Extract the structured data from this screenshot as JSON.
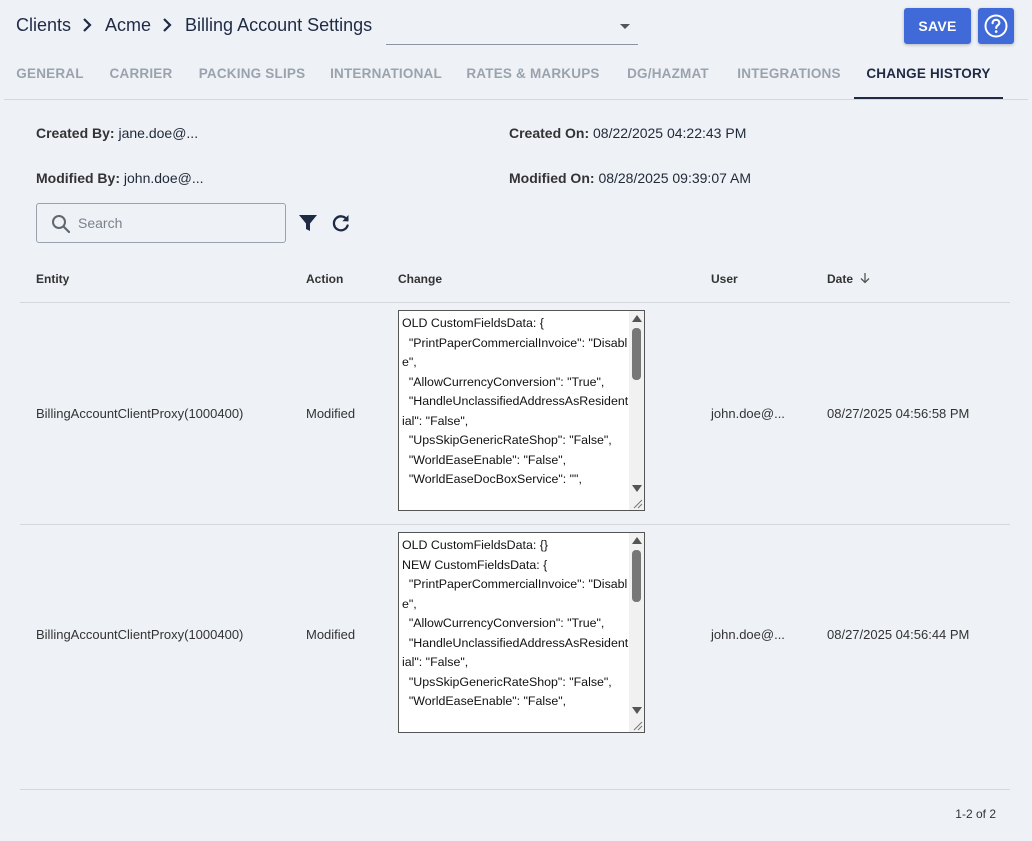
{
  "breadcrumb": {
    "items": [
      "Clients",
      "Acme",
      "Billing Account Settings"
    ]
  },
  "selector": {
    "value": ""
  },
  "actions": {
    "save_label": "SAVE"
  },
  "tabs": [
    {
      "label": "GENERAL",
      "active": false
    },
    {
      "label": "CARRIER",
      "active": false
    },
    {
      "label": "PACKING SLIPS",
      "active": false
    },
    {
      "label": "INTERNATIONAL",
      "active": false
    },
    {
      "label": "RATES & MARKUPS",
      "active": false
    },
    {
      "label": "DG/HAZMAT",
      "active": false
    },
    {
      "label": "INTEGRATIONS",
      "active": false
    },
    {
      "label": "CHANGE HISTORY",
      "active": true
    }
  ],
  "meta": {
    "created_by_label": "Created By:",
    "created_by": "jane.doe@...",
    "created_on_label": "Created On:",
    "created_on": "08/22/2025 04:22:43 PM",
    "modified_by_label": "Modified By:",
    "modified_by": "john.doe@...",
    "modified_on_label": "Modified On:",
    "modified_on": "08/28/2025 09:39:07 AM"
  },
  "search": {
    "placeholder": "Search",
    "value": ""
  },
  "table": {
    "columns": [
      "Entity",
      "Action",
      "Change",
      "User",
      "Date"
    ],
    "sort_column": "Date",
    "sort_direction": "desc",
    "rows": [
      {
        "entity": "BillingAccountClientProxy(1000400)",
        "action": "Modified",
        "change": "OLD CustomFieldsData: {\n  \"PrintPaperCommercialInvoice\": \"Disable\",\n  \"AllowCurrencyConversion\": \"True\",\n  \"HandleUnclassifiedAddressAsResidential\": \"False\",\n  \"UpsSkipGenericRateShop\": \"False\",\n  \"WorldEaseEnable\": \"False\",\n  \"WorldEaseDocBoxService\": \"\",",
        "user": "john.doe@...",
        "date": "08/27/2025 04:56:58 PM"
      },
      {
        "entity": "BillingAccountClientProxy(1000400)",
        "action": "Modified",
        "change": "OLD CustomFieldsData: {}\nNEW CustomFieldsData: {\n  \"PrintPaperCommercialInvoice\": \"Disable\",\n  \"AllowCurrencyConversion\": \"True\",\n  \"HandleUnclassifiedAddressAsResidential\": \"False\",\n  \"UpsSkipGenericRateShop\": \"False\",\n  \"WorldEaseEnable\": \"False\",",
        "user": "john.doe@...",
        "date": "08/27/2025 04:56:44 PM"
      }
    ]
  },
  "pagination": {
    "text": "1-2 of 2"
  },
  "colors": {
    "background": "#eef1f6",
    "primary": "#3f6ad8",
    "tab_active": "#1f2a44",
    "tab_inactive": "#9aa3ad"
  }
}
